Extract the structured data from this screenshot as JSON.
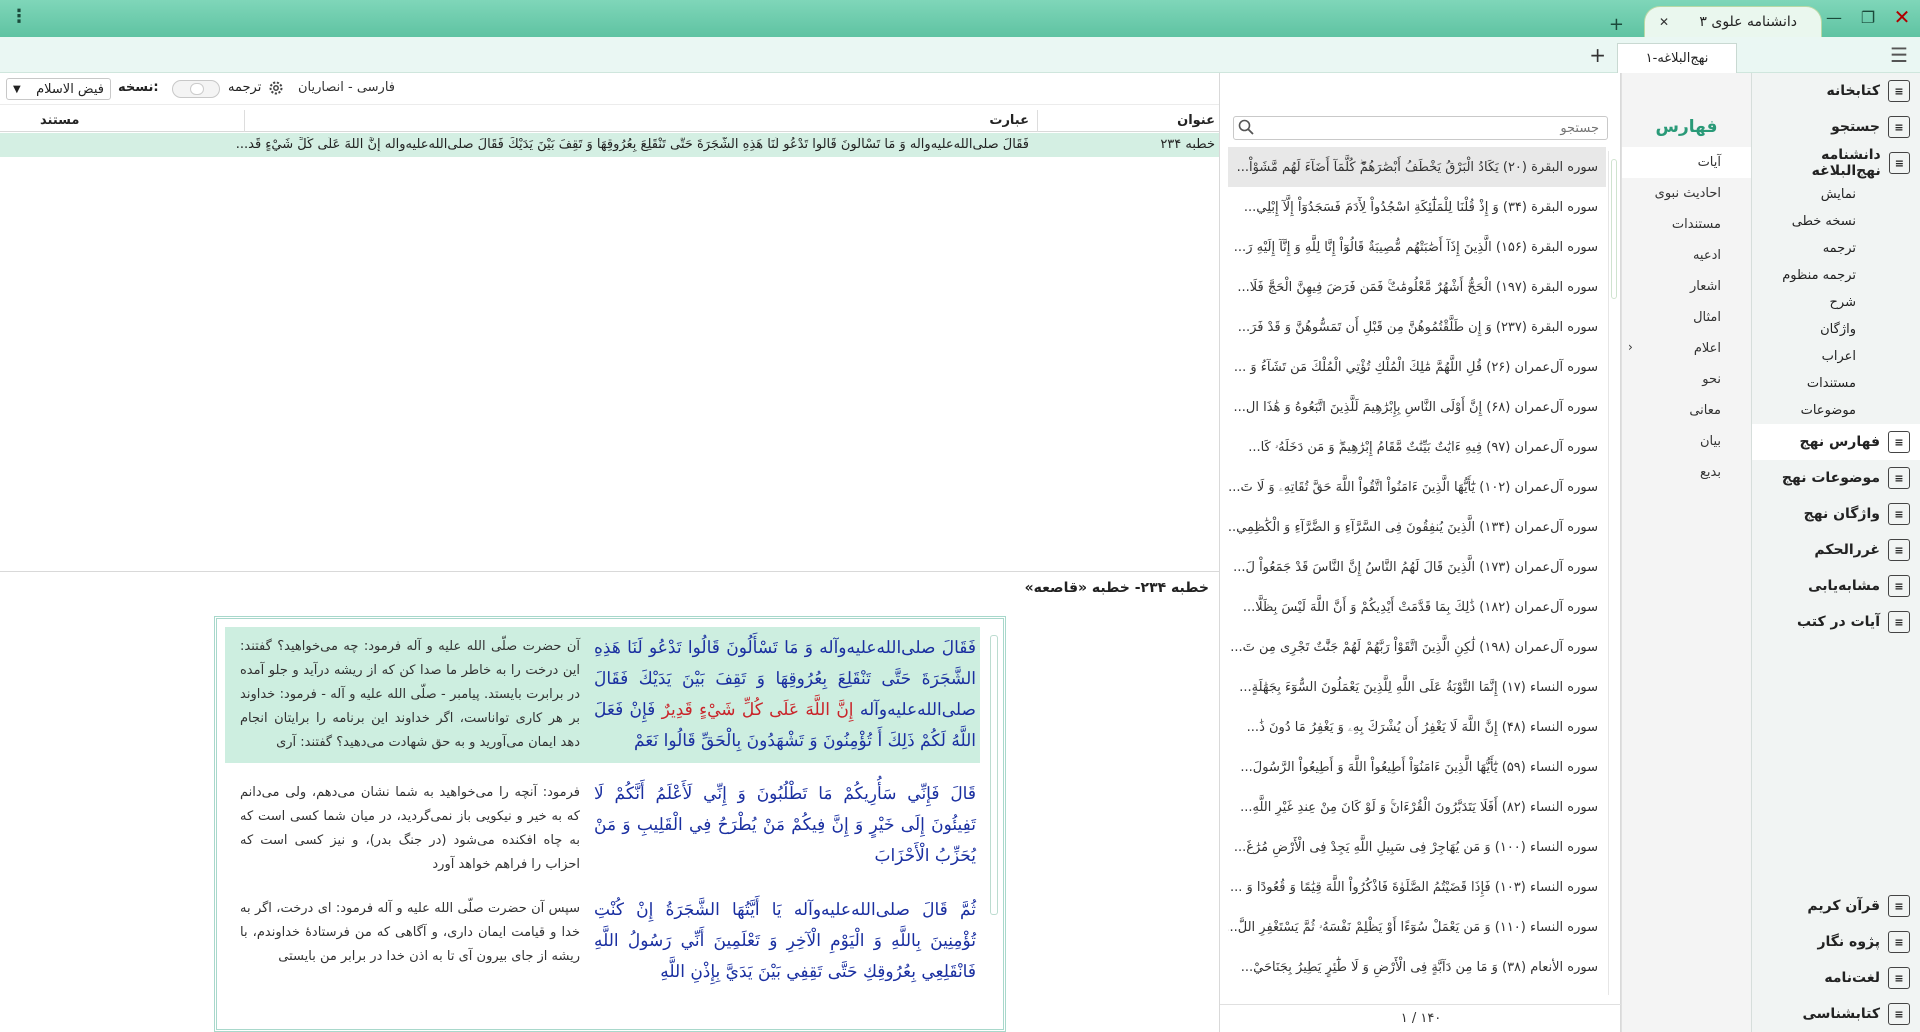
{
  "titlebar": {
    "app_tab_label": "دانشنامه علوی ۳",
    "controls": [
      "minimize",
      "restore",
      "close"
    ]
  },
  "doc_tab": {
    "label": "نهج‌البلاغه-۱"
  },
  "toolbar": {
    "lang": "فارسی - انصاریان",
    "translation_label": "ترجمه",
    "edition_label": "نسخه:",
    "edition_value": "فیض الاسلام"
  },
  "table": {
    "headers": {
      "title": "عنوان",
      "text": "عبارت",
      "doc": "مستند"
    },
    "rows": [
      {
        "title": "خطبه ۲۳۴",
        "text": "فَقَالَ صلى‌الله‌عليه‌وآله وَ مَا تَسْأَلُونَ قَالُوا تَدْعُو لَنَا هَذِهِ الشَّجَرَةَ حَتَّى تَنْقَلِعَ بِعُرُوقِهَا وَ تَقِفَ بَيْنَ يَدَيْكَ فَقَالَ صلى‌الله‌عليه‌وآله إِنَّ اللَّهَ عَلَى كُلِّ شَيْءٍ قَد...",
        "doc": ""
      }
    ]
  },
  "detail": {
    "title": "خطبه ۲۳۴- خطبه «قاصعه»",
    "paragraphs": [
      {
        "ar_pre": "فَقَالَ صلى‌الله‌عليه‌وآله وَ مَا تَسْأَلُونَ قَالُوا تَدْعُو لَنَا هَذِهِ الشَّجَرَةَ حَتَّى تَنْقَلِعَ بِعُرُوقِهَا وَ تَقِفَ بَيْنَ يَدَيْكَ فَقَالَ صلى‌الله‌عليه‌وآله ",
        "ar_red": "إِنَّ اللَّهَ عَلَى كُلِّ شَيْءٍ قَدِيرٌ",
        "ar_post": " فَإِنْ فَعَلَ اللَّهُ لَكُمْ ذَلِكَ أَ تُؤْمِنُونَ وَ تَشْهَدُونَ بِالْحَقِّ قَالُوا نَعَمْ",
        "fa": "آن حضرت صلّى الله عليه و آله فرمود: چه مى‌خواهيد؟ گفتند: اين درخت را به خاطر ما صدا كن كه از ريشه درآيد و جلو آمده در برابرت بايستد. پيامبر - صلّى الله عليه و آله - فرمود: خداوند بر هر كارى تواناست، اگر خداوند اين برنامه را برايتان انجام دهد ايمان مى‌آوريد و به حق شهادت مى‌دهيد؟ گفتند: آرى"
      },
      {
        "ar_pre": "قَالَ فَإِنِّي سَأُرِيكُمْ مَا تَطْلُبُونَ وَ إِنِّي لَأَعْلَمُ أَنَّكُمْ لَا تَفِيئُونَ إِلَى خَيْرٍ وَ إِنَّ فِيكُمْ مَنْ يُطْرَحُ فِي الْقَلِيبِ وَ مَنْ يُحَزِّبُ الْأَحْزَابَ",
        "ar_red": "",
        "ar_post": "",
        "fa": "فرمود: آنچه را مى‌خواهيد به شما نشان مى‌دهم، ولى مى‌دانم كه به خير و نيكويى باز نمى‌گرديد، در ميان شما كسى است كه به چاه افكنده مى‌شود (در جنگ بدر)، و نيز كسى است كه احزاب را فراهم خواهد آورد"
      },
      {
        "ar_pre": "ثُمَّ قَالَ صلى‌الله‌عليه‌وآله يَا أَيَّتُهَا الشَّجَرَةُ إِنْ كُنْتِ تُؤْمِنِينَ بِاللَّهِ وَ الْيَوْمِ الْآخِرِ وَ تَعْلَمِينَ أَنِّي رَسُولُ اللَّهِ فَانْقَلِعِي بِعُرُوقِكِ حَتَّى تَقِفِي بَيْنَ يَدَيَّ بِإِذْنِ اللَّهِ",
        "ar_red": "",
        "ar_post": "",
        "fa": "سپس آن حضرت صلّى الله عليه و آله فرمود: اى درخت، اگر به خدا و قيامت ايمان دارى، و آگاهى كه من فرستادۀ خداوندم، با ريشه از جاى بيرون آى تا به اذن خدا در برابر من بايستى"
      }
    ]
  },
  "verse_list": {
    "search_placeholder": "جستجو",
    "items": [
      "سوره البقرة (۲۰) يَكَادُ الْبَرْقُ يَخْطَفُ أَبْصَٰرَهُمْ‌ۖ كُلَّمَآ أَضَآءَ لَهُم مَّشَوْاْ...",
      "سوره البقرة (۳۴) وَ إِذْ قُلْنَا لِلْمَلَٰٓئِكَةِ اسْجُدُواْ لِأٓدَمَ فَسَجَدُوٓاْ إِلَّآ إِبْلِي...",
      "سوره البقرة (۱۵۶) الَّذِينَ إِذَآ أَصَٰبَتْهُم مُّصِيبَةٌ قَالُوٓاْ إِنَّا لِلَّهِ وَ إِنَّآ إِلَيْهِ رَ...",
      "سوره البقرة (۱۹۷) الْحَجُّ أَشْهُرٌ مَّعْلُومَٰتٌ‌ۚ فَمَن فَرَضَ فِيهِنَّ الْحَجَّ فَلَا...",
      "سوره البقرة (۲۳۷) وَ إِن طَلَّقْتُمُوهُنَّ مِن قَبْلِ أَن تَمَسُّوهُنَّ وَ قَدْ فَرَ...",
      "سوره آل‌عمران (۲۶) قُلِ اللَّهُمَّ مَٰلِكَ الْمُلْكِ تُؤْتِي الْمُلْكَ مَن تَشَآءُ وَ ...",
      "سوره آل‌عمران (۶۸) إِنَّ أَوْلَى النَّاسِ بِإِبْرَٰهِيمَ لَلَّذِينَ اتَّبَعُوهُ وَ هَٰذَا ال...",
      "سوره آل‌عمران (۹۷) فِيهِ ءَايَٰتٌ بَيِّنَٰتٌ مَّقَامُ إِبْرَٰهِيمَ‌ۖ وَ مَن دَخَلَهُۥ كَا...",
      "سوره آل‌عمران (۱۰۲) يَٰٓأَيُّهَا الَّذِينَ ءَامَنُواْ اتَّقُواْ اللَّهَ حَقَّ تُقَاتِهِۦ وَ لَا تَ...",
      "سوره آل‌عمران (۱۳۴) الَّذِينَ يُنفِقُونَ فِى السَّرَّآءِ وَ الضَّرَّآءِ وَ الْكَٰظِمِي...",
      "سوره آل‌عمران (۱۷۳) الَّذِينَ قَالَ لَهُمُ النَّاسُ إِنَّ النَّاسَ قَدْ جَمَعُواْ لَ...",
      "سوره آل‌عمران (۱۸۲) ذَٰلِكَ بِمَا قَدَّمَتْ أَيْدِيكُمْ وَ أَنَّ اللَّهَ لَيْسَ بِظَلَّا...",
      "سوره آل‌عمران (۱۹۸) لَٰكِنِ الَّذِينَ اتَّقَوْاْ رَبَّهُمْ لَهُمْ جَنَّٰتٌ تَجْرِى مِن تَ...",
      "سوره النساء (۱۷) إِنَّمَا التَّوْبَةُ عَلَى اللَّهِ لِلَّذِينَ يَعْمَلُونَ السُّوٓءَ بِجَهَٰلَةٍ...",
      "سوره النساء (۴۸) إِنَّ اللَّهَ لَا يَغْفِرُ أَن يُشْرَكَ بِهِۦ وَ يَغْفِرُ مَا دُونَ ذَٰ...",
      "سوره النساء (۵۹) يَٰٓأَيُّهَا الَّذِينَ ءَامَنُوٓاْ أَطِيعُواْ اللَّهَ وَ أَطِيعُواْ الرَّسُولَ...",
      "سوره النساء (۸۲) أَفَلَا يَتَدَبَّرُونَ الْقُرْءَانَ‌ۚ وَ لَوْ كَانَ مِنْ عِندِ غَيْرِ اللَّهِ...",
      "سوره النساء (۱۰۰) وَ مَن يُهَاجِرْ فِى سَبِيلِ اللَّهِ يَجِدْ فِى الْأَرْضِ مُرَٰغَ...",
      "سوره النساء (۱۰۳) فَإِذَا قَضَيْتُمُ الصَّلَوٰةَ فَاذْكُرُواْ اللَّهَ قِيَٰمًا وَ قُعُودًا وَ ...",
      "سوره النساء (۱۱۰) وَ مَن يَعْمَلْ سُوٓءًا أَوْ يَظْلِمْ نَفْسَهُۥ ثُمَّ يَسْتَغْفِرِ اللَّ...",
      "سوره الأنعام (۳۸) وَ مَا مِن دَآبَّةٍ فِى الْأَرْضِ وَ لَا طَٰٓئِرٍ يَطِيرُ بِجَنَاحَيْ..."
    ],
    "active_index": 0,
    "footer": "۱ / ۱۴۰"
  },
  "categories": {
    "title": "فهارس",
    "items": [
      "آیات",
      "احادیث نبوی",
      "مستندات",
      "ادعیه",
      "اشعار",
      "امثال",
      "اعلام",
      "نحو",
      "معانی",
      "بیان",
      "بدیع"
    ],
    "active_index": 0
  },
  "nav": {
    "main": [
      {
        "label": "کتابخانه",
        "icon": "library-icon"
      },
      {
        "label": "جستجو",
        "icon": "search-icon"
      },
      {
        "label": "دانشنامه نهج‌البلاغه",
        "icon": "encyclopedia-icon"
      }
    ],
    "sub": [
      "نمایش",
      "نسخه خطی",
      "ترجمه",
      "ترجمه منظوم",
      "شرح",
      "واژگان",
      "اعراب",
      "مستندات",
      "موضوعات"
    ],
    "main2": [
      {
        "label": "فهارس نهج",
        "icon": "index-icon"
      },
      {
        "label": "موضوعات نهج",
        "icon": "topics-icon"
      },
      {
        "label": "واژگان نهج",
        "icon": "vocab-icon"
      },
      {
        "label": "غررالحکم",
        "icon": "ghorar-icon"
      },
      {
        "label": "مشابه‌یابی",
        "icon": "similar-icon"
      },
      {
        "label": "آیات در کتب",
        "icon": "verses-in-books-icon"
      }
    ],
    "bottom": [
      {
        "label": "قرآن کریم",
        "icon": "quran-icon"
      },
      {
        "label": "پژوه نگار",
        "icon": "research-icon"
      },
      {
        "label": "لغت‌نامه",
        "icon": "dictionary-icon"
      },
      {
        "label": "کتابشناسی",
        "icon": "info-icon"
      }
    ]
  },
  "colors": {
    "accent": "#5fc3a2",
    "selected_row": "#d4efe3",
    "arabic_text": "#1a2fa0",
    "quran_highlight": "#c9242a"
  }
}
